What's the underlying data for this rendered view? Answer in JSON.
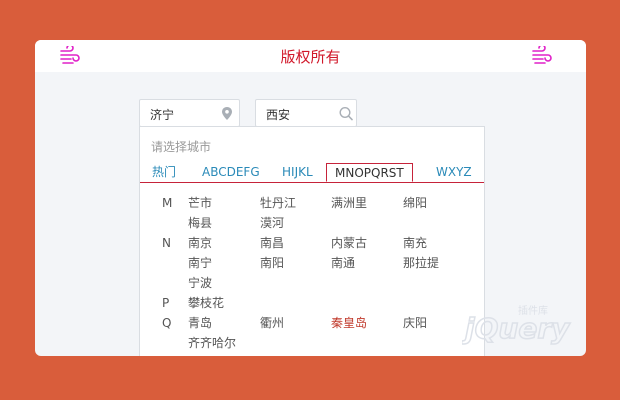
{
  "header": {
    "title": "版权所有",
    "left_icon": "wind-icon",
    "right_icon": "wind-icon",
    "accent": "#d1182a",
    "icon_color": "#e020c8"
  },
  "from_field": {
    "value": "济宁",
    "icon": "location-pin-icon"
  },
  "to_field": {
    "value": "西安",
    "icon": "search-icon"
  },
  "picker": {
    "hint": "请选择城市",
    "tabs": [
      {
        "label": "热门",
        "active": false
      },
      {
        "label": "ABCDEFG",
        "active": false
      },
      {
        "label": "HIJKL",
        "active": false
      },
      {
        "label": "MNOPQRST",
        "active": true
      },
      {
        "label": "WXYZ",
        "active": false
      }
    ],
    "groups": [
      {
        "letter": "M",
        "rows": [
          [
            "芒市",
            "牡丹江",
            "满洲里",
            "绵阳"
          ],
          [
            "梅县",
            "漠河"
          ]
        ]
      },
      {
        "letter": "N",
        "rows": [
          [
            "南京",
            "南昌",
            "内蒙古",
            "南充"
          ],
          [
            "南宁",
            "南阳",
            "南通",
            "那拉提"
          ],
          [
            "宁波"
          ]
        ]
      },
      {
        "letter": "P",
        "rows": [
          [
            "攀枝花"
          ]
        ]
      },
      {
        "letter": "Q",
        "rows": [
          [
            "青岛",
            "衢州",
            "秦皇岛",
            "庆阳"
          ],
          [
            "齐齐哈尔"
          ]
        ]
      }
    ],
    "highlighted_city": "秦皇岛",
    "highlight_color": "#c0392b"
  },
  "watermark": {
    "text": "jQuery",
    "subtext": "插件库"
  }
}
